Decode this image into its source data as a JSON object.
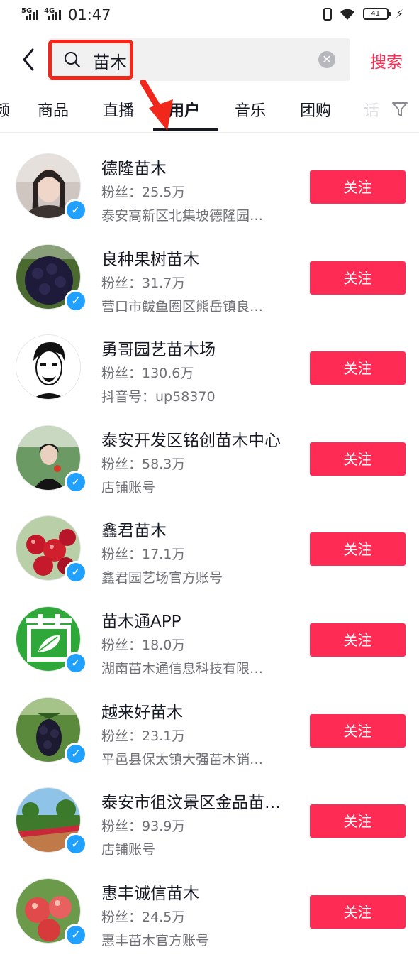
{
  "status_bar": {
    "network_1": "5G",
    "network_2": "4G",
    "time": "01:47",
    "battery": "41"
  },
  "search": {
    "query": "苗木",
    "button": "搜索"
  },
  "tabs": [
    "频",
    "商品",
    "直播",
    "用户",
    "音乐",
    "团购",
    "话"
  ],
  "active_tab": "用户",
  "colors": {
    "accent": "#fe2c55",
    "verified": "#20a0ff",
    "highlight_box": "#f2271c"
  },
  "users": [
    {
      "name": "德隆苗木",
      "fans": "粉丝：25.5万",
      "desc": "泰安高新区北集坡德隆园…",
      "follow": "关注",
      "verified": true
    },
    {
      "name": "良种果树苗木",
      "fans": "粉丝：31.7万",
      "desc": "营口市鲅鱼圈区熊岳镇良…",
      "follow": "关注",
      "verified": true
    },
    {
      "name": "勇哥园艺苗木场",
      "fans": "粉丝：130.6万",
      "desc": "抖音号：up58370",
      "follow": "关注",
      "verified": false
    },
    {
      "name": "泰安开发区铭创苗木中心",
      "fans": "粉丝：58.3万",
      "desc": "店铺账号",
      "follow": "关注",
      "verified": true
    },
    {
      "name": "鑫君苗木",
      "fans": "粉丝：17.1万",
      "desc": "鑫君园艺场官方账号",
      "follow": "关注",
      "verified": true
    },
    {
      "name": "苗木通APP",
      "fans": "粉丝：18.0万",
      "desc": "湖南苗木通信息科技有限…",
      "follow": "关注",
      "verified": true
    },
    {
      "name": "越来好苗木",
      "fans": "粉丝：23.1万",
      "desc": "平邑县保太镇大强苗木销…",
      "follow": "关注",
      "verified": true
    },
    {
      "name": "泰安市徂汶景区金品苗…",
      "fans": "粉丝：93.9万",
      "desc": "店铺账号",
      "follow": "关注",
      "verified": true
    },
    {
      "name": "惠丰诚信苗木",
      "fans": "粉丝：24.5万",
      "desc": "惠丰苗木官方账号",
      "follow": "关注",
      "verified": true
    }
  ]
}
